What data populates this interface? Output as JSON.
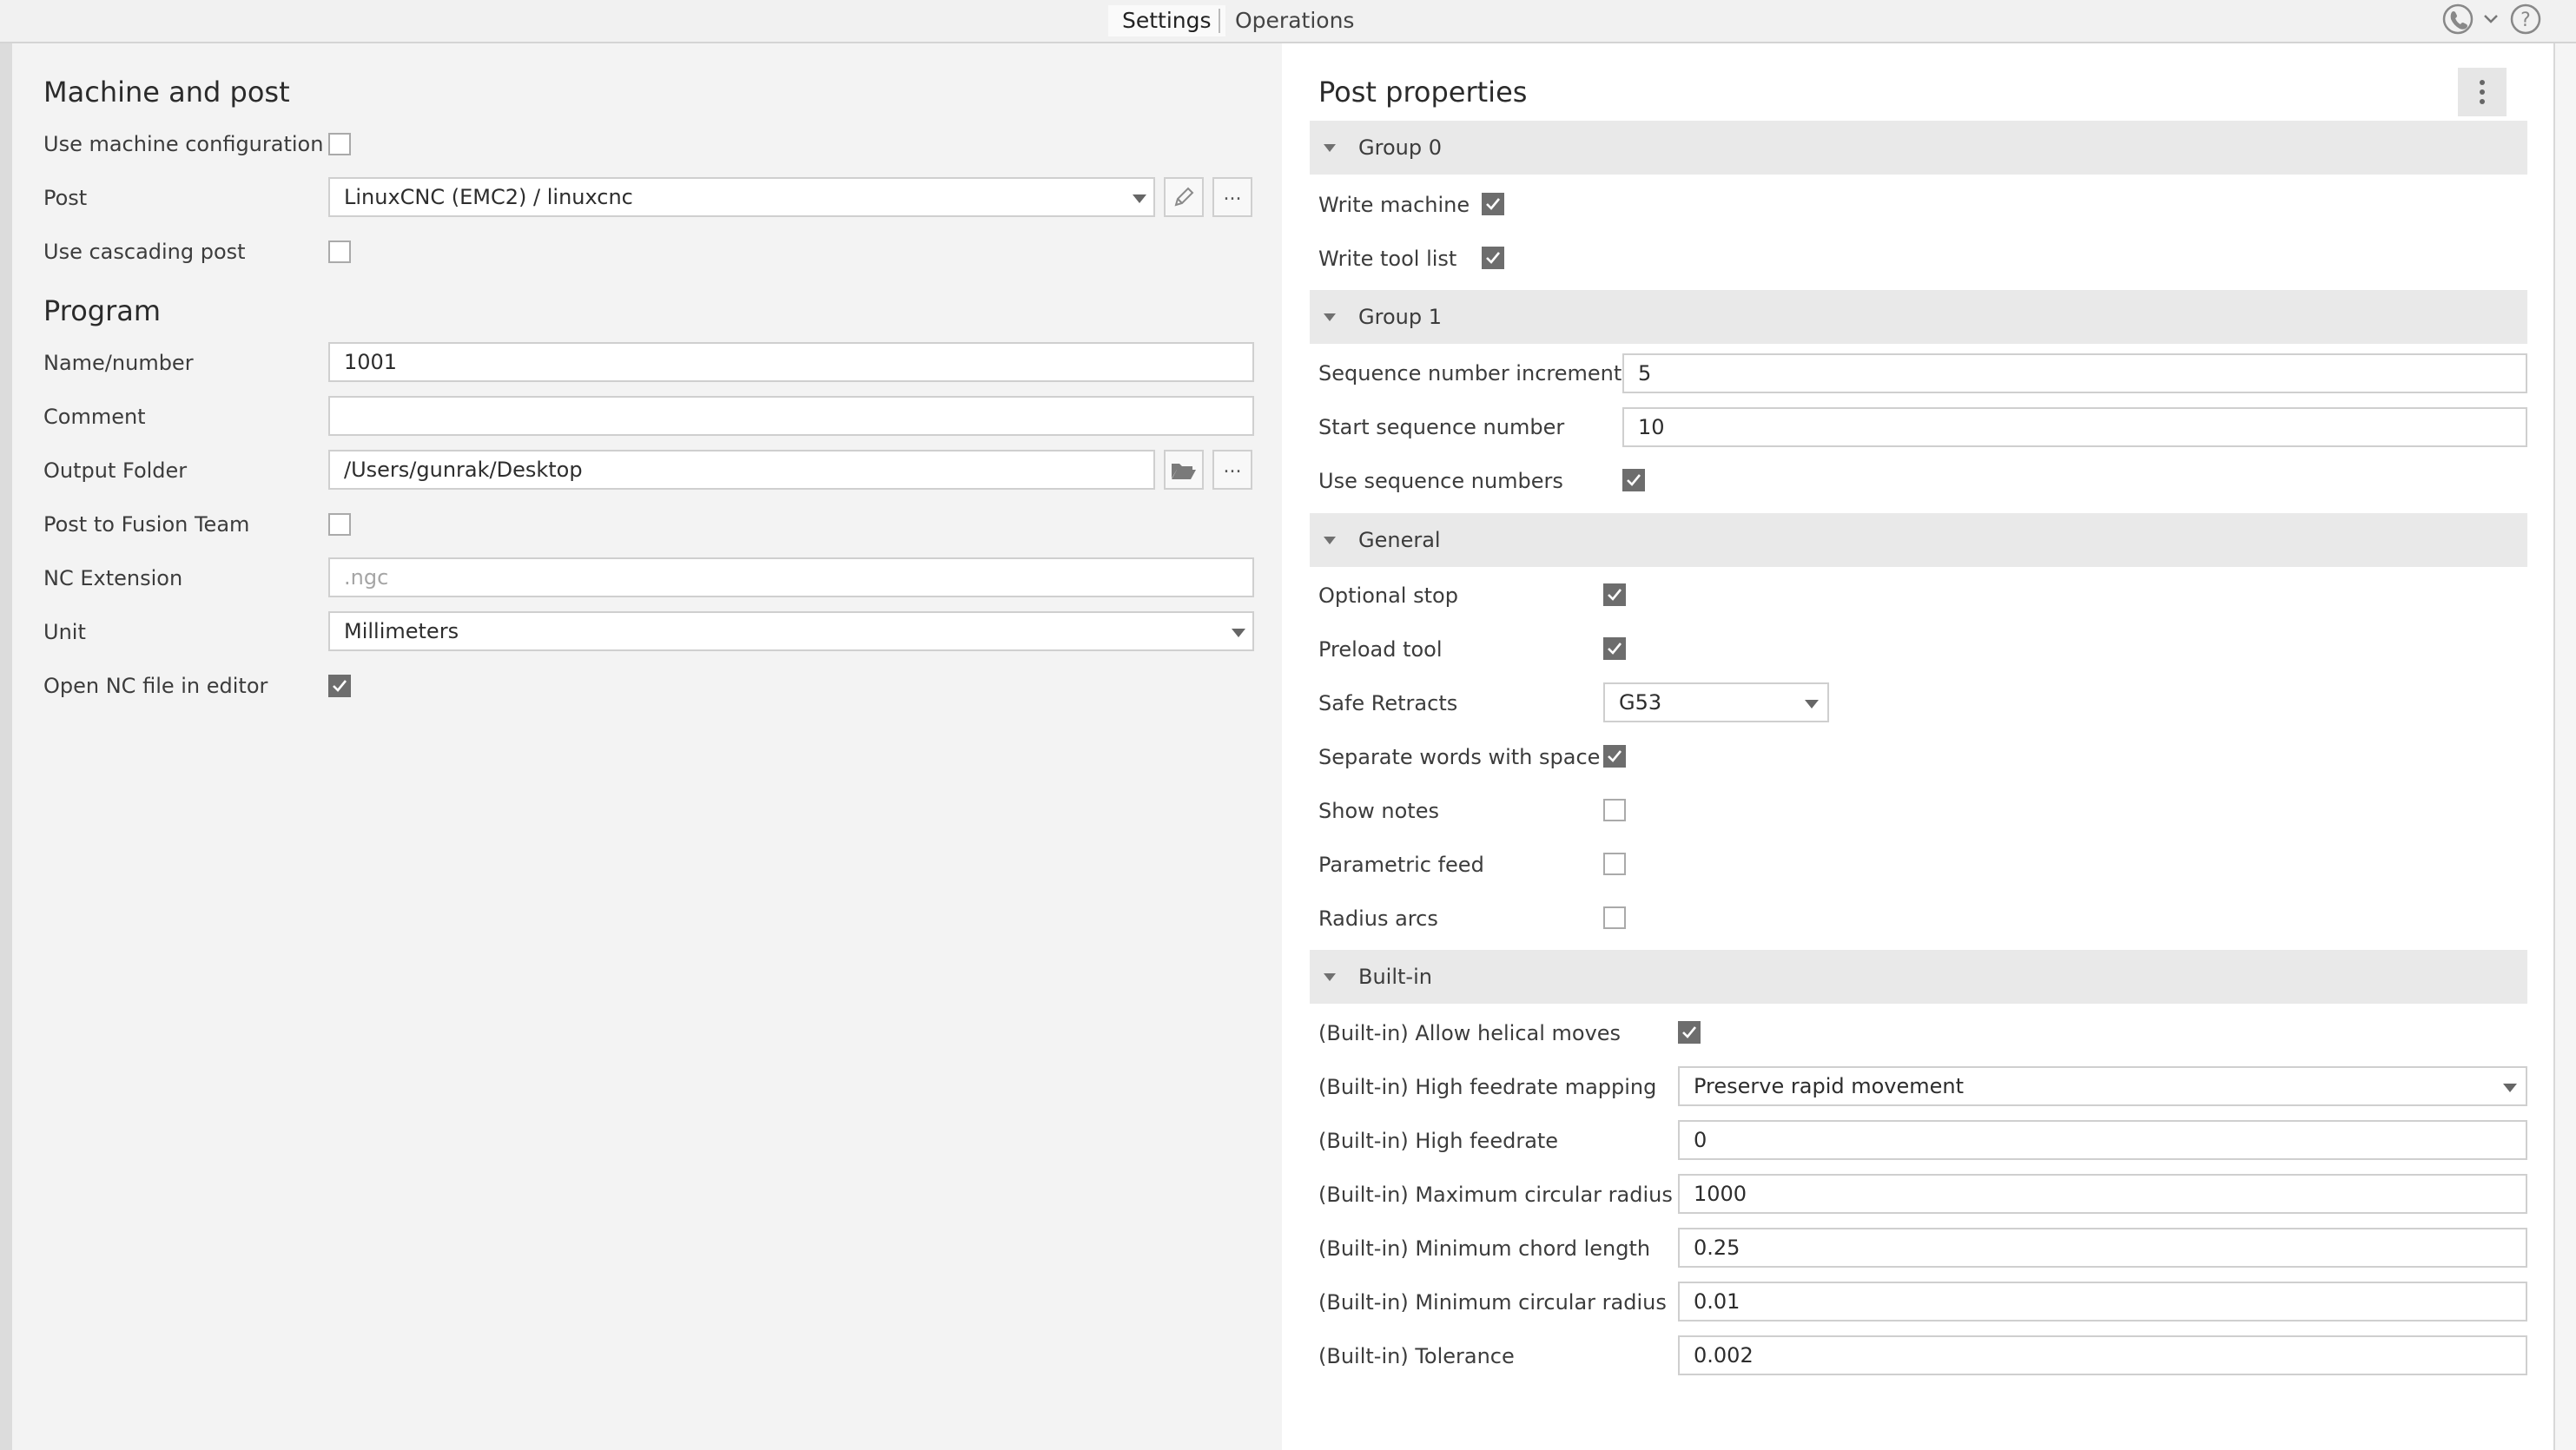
{
  "tabs": {
    "settings": "Settings",
    "operations": "Operations"
  },
  "left": {
    "machine_title": "Machine and post",
    "use_machine_config_label": "Use machine configuration",
    "post_label": "Post",
    "post_value": "LinuxCNC (EMC2) / linuxcnc",
    "more_label": "...",
    "use_cascading_label": "Use cascading post",
    "program_title": "Program",
    "name_label": "Name/number",
    "name_value": "1001",
    "comment_label": "Comment",
    "comment_value": "",
    "output_folder_label": "Output Folder",
    "output_folder_value": "/Users/gunrak/Desktop",
    "post_fusion_label": "Post to Fusion Team",
    "nc_ext_label": "NC Extension",
    "nc_ext_placeholder": ".ngc",
    "unit_label": "Unit",
    "unit_value": "Millimeters",
    "open_nc_label": "Open NC file in editor"
  },
  "checks": {
    "use_machine_config": false,
    "use_cascading": false,
    "post_fusion": false,
    "open_nc": true
  },
  "right": {
    "title": "Post properties",
    "group0": {
      "title": "Group 0",
      "write_machine": "Write machine",
      "write_machine_checked": true,
      "write_tool_list": "Write tool list",
      "write_tool_list_checked": true
    },
    "group1": {
      "title": "Group 1",
      "seq_inc_label": "Sequence number increment",
      "seq_inc_value": "5",
      "start_seq_label": "Start sequence number",
      "start_seq_value": "10",
      "use_seq_label": "Use sequence numbers",
      "use_seq_checked": true
    },
    "general": {
      "title": "General",
      "optional_stop": "Optional stop",
      "optional_stop_checked": true,
      "preload_tool": "Preload tool",
      "preload_tool_checked": true,
      "safe_retracts": "Safe Retracts",
      "safe_retracts_value": "G53",
      "separate_words": "Separate words with space",
      "separate_words_checked": true,
      "show_notes": "Show notes",
      "show_notes_checked": false,
      "parametric_feed": "Parametric feed",
      "parametric_feed_checked": false,
      "radius_arcs": "Radius arcs",
      "radius_arcs_checked": false
    },
    "builtin": {
      "title": "Built-in",
      "helical": "(Built-in) Allow helical moves",
      "helical_checked": true,
      "hf_mapping": "(Built-in) High feedrate mapping",
      "hf_mapping_value": "Preserve rapid movement",
      "hf": "(Built-in) High feedrate",
      "hf_value": "0",
      "max_circ": "(Built-in) Maximum circular radius",
      "max_circ_value": "1000",
      "min_chord": "(Built-in) Minimum chord length",
      "min_chord_value": "0.25",
      "min_circ": "(Built-in) Minimum circular radius",
      "min_circ_value": "0.01",
      "tolerance": "(Built-in) Tolerance",
      "tolerance_value": "0.002"
    }
  },
  "icons": {
    "pencil": "pencil-icon",
    "folder": "folder-open-icon",
    "kebab": "more-vertical-icon",
    "phone": "phone-icon",
    "help": "help-icon"
  }
}
